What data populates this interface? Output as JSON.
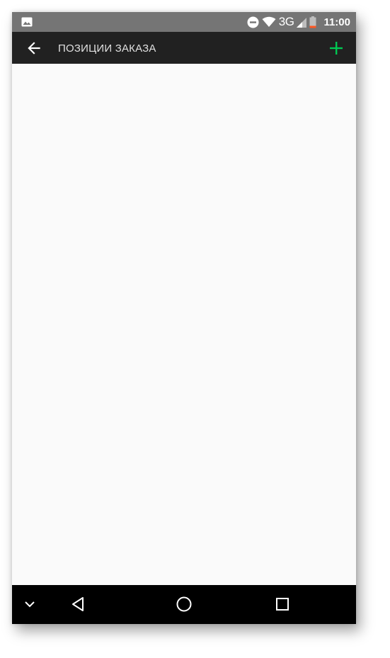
{
  "status_bar": {
    "network": "3G",
    "time": "11:00",
    "icons": [
      "image-notification-icon",
      "do-not-disturb-icon",
      "wifi-icon",
      "cell-signal-icon",
      "battery-low-icon"
    ],
    "battery_color": "#ff5722"
  },
  "app_bar": {
    "title": "ПОЗИЦИИ ЗАКАЗА",
    "back_icon": "arrow-back-icon",
    "add_icon": "plus-icon",
    "add_color": "#00c853"
  },
  "nav_bar": {
    "icons": [
      "chevron-down-icon",
      "back-triangle-icon",
      "home-circle-icon",
      "recents-square-icon"
    ]
  },
  "colors": {
    "status_bar_bg": "#757575",
    "app_bar_bg": "#212121",
    "content_bg": "#fafafa",
    "nav_bar_bg": "#000000"
  }
}
